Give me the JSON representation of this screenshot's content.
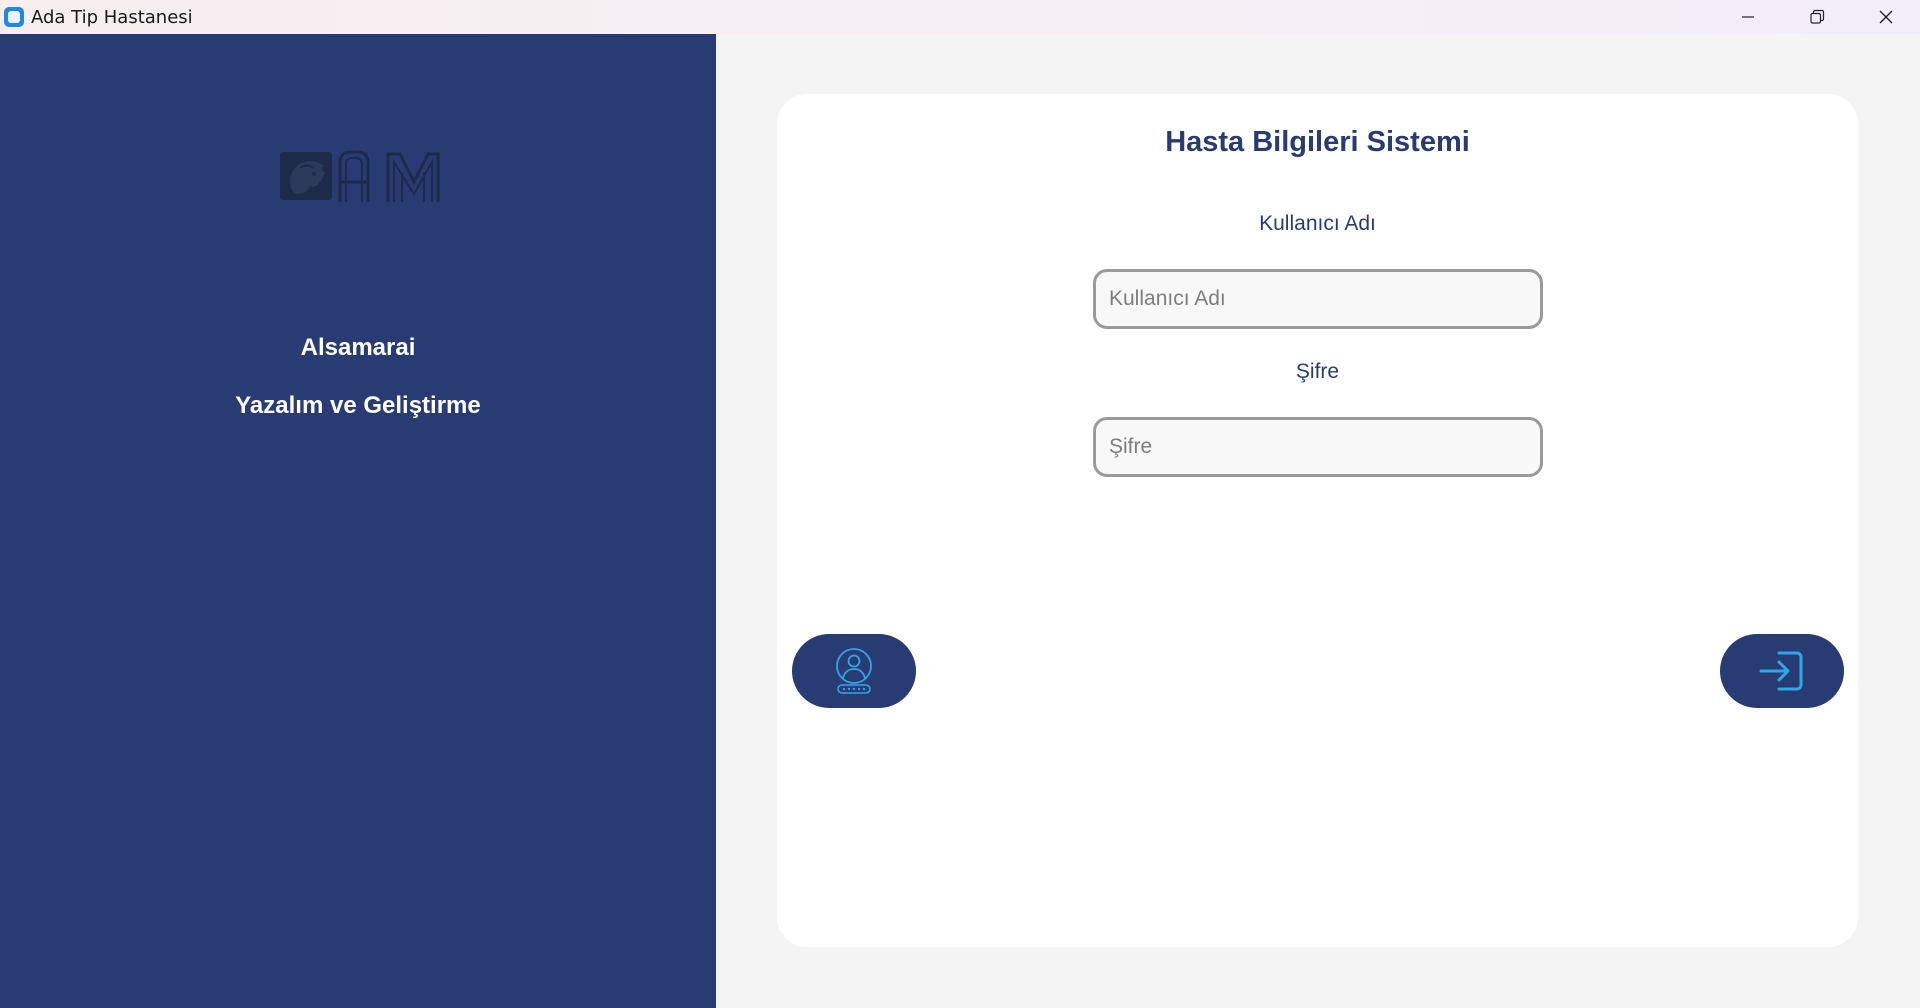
{
  "window": {
    "title": "Ada Tip Hastanesi",
    "icons": [
      "app-icon",
      "minimize-icon",
      "restore-icon",
      "close-icon"
    ]
  },
  "sidebar": {
    "logo_icon": "lion-am-logo-icon",
    "company_name": "Alsamarai",
    "tagline": "Yazalım ve Geliştirme",
    "background": "#283c73"
  },
  "login": {
    "title": "Hasta Bilgileri Sistemi",
    "username_label": "Kullanıcı Adı",
    "username_placeholder": "Kullanıcı Adı",
    "username_value": "",
    "password_label": "Şifre",
    "password_placeholder": "Şifre",
    "password_value": "",
    "left_button_icon": "user-password-icon",
    "right_button_icon": "login-icon"
  },
  "colors": {
    "primary": "#283c73",
    "icon_accent": "#2fa6e6",
    "card": "#ffffff",
    "page_background": "#f4f4f4"
  }
}
